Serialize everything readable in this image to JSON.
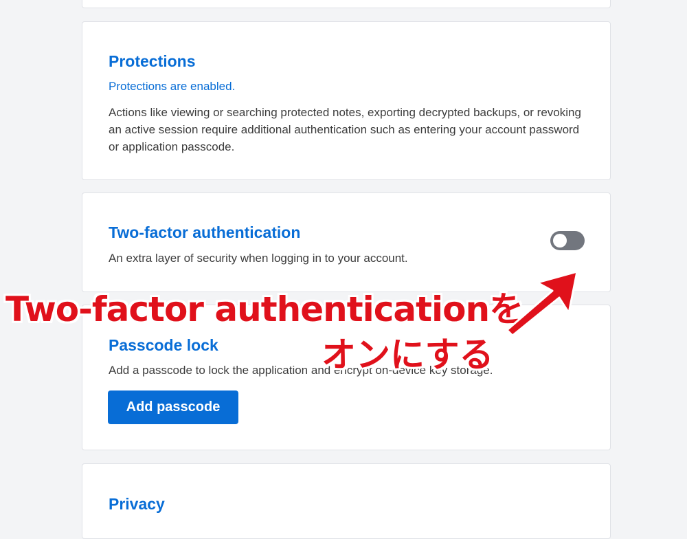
{
  "protections": {
    "title": "Protections",
    "status": "Protections are enabled.",
    "description": "Actions like viewing or searching protected notes, exporting decrypted backups, or revoking an active session require additional authentication such as entering your account password or application passcode."
  },
  "two_factor": {
    "title": "Two-factor authentication",
    "description": "An extra layer of security when logging in to your account.",
    "enabled": false
  },
  "passcode_lock": {
    "title": "Passcode lock",
    "description": "Add a passcode to lock the application and encrypt on-device key storage.",
    "button_label": "Add passcode"
  },
  "privacy": {
    "title": "Privacy"
  },
  "annotation": {
    "line1": "Two-factor authenticationを",
    "line2": "オンにする",
    "color": "#e0111b"
  },
  "colors": {
    "accent": "#086dd6",
    "toggle_off": "#72767e",
    "background": "#f3f4f6"
  },
  "icons": {
    "arrow": "arrow-icon"
  }
}
